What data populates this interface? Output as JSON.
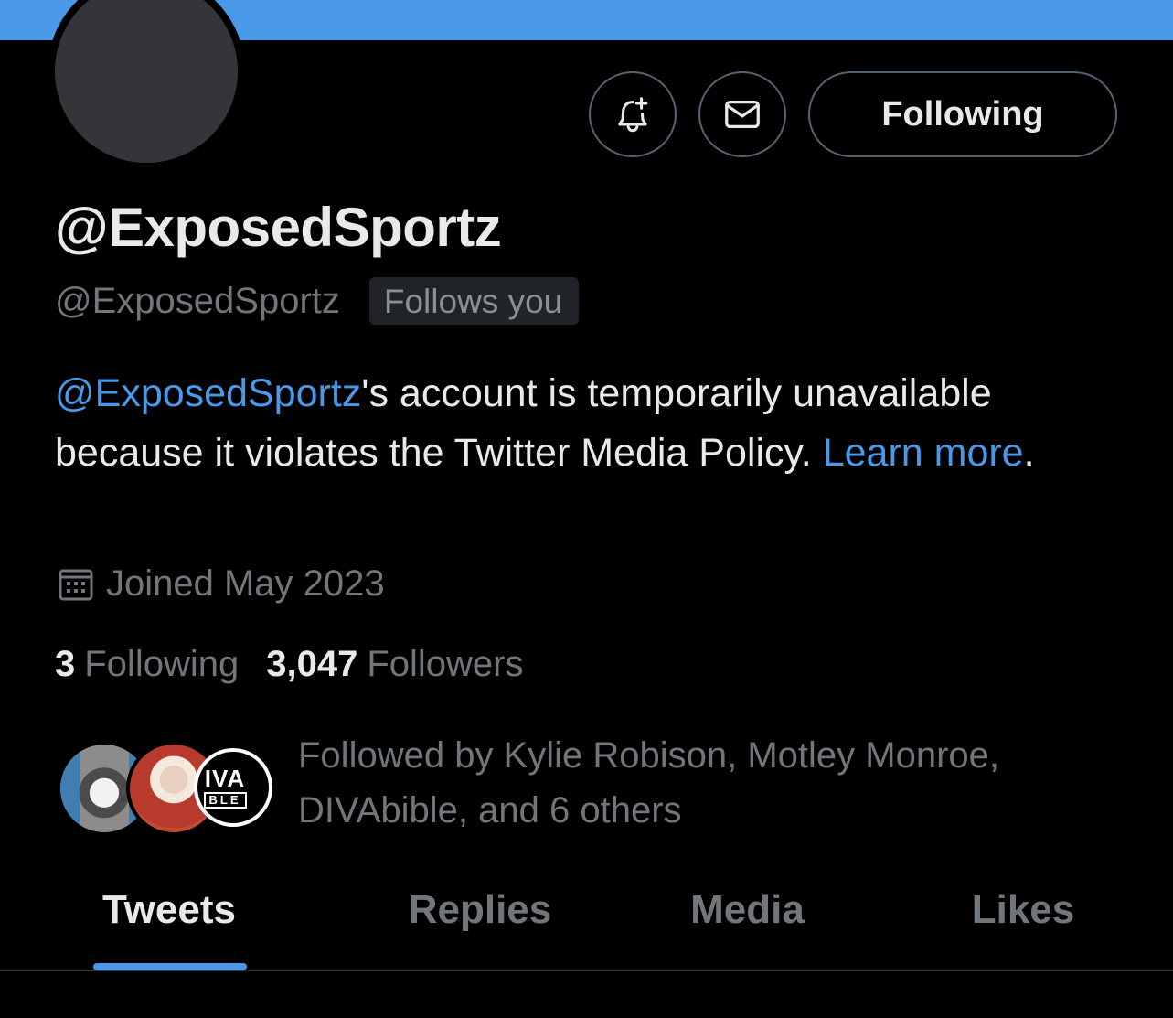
{
  "theme": {
    "banner_color": "#4a99e9",
    "accent_color": "#1d9bf0",
    "tab_indicator_color": "#4a99e9",
    "background": "#000000"
  },
  "header": {
    "actions": {
      "notify_icon": "bell-plus-icon",
      "message_icon": "envelope-icon",
      "follow_state_label": "Following"
    }
  },
  "profile": {
    "display_name": "@ExposedSportz",
    "handle": "@ExposedSportz",
    "follows_you_badge": "Follows you",
    "bio": {
      "mention": "@ExposedSportz",
      "text": "'s account is temporarily unavailable because it violates the Twitter Media Policy. ",
      "learn_more": "Learn more",
      "trailing": "."
    },
    "joined_icon": "calendar-icon",
    "joined": "Joined May 2023",
    "stats": {
      "following_count": "3",
      "following_label": "Following",
      "followers_count": "3,047",
      "followers_label": "Followers"
    },
    "followers_you_know": {
      "text": "Followed by Kylie Robison, Motley Monroe, DIVAbible, and 6 others",
      "avatar3_line1": "IVA",
      "avatar3_line2": "BLE"
    }
  },
  "tabs": [
    {
      "label": "Tweets",
      "active": true
    },
    {
      "label": "Replies",
      "active": false
    },
    {
      "label": "Media",
      "active": false
    },
    {
      "label": "Likes",
      "active": false
    }
  ]
}
